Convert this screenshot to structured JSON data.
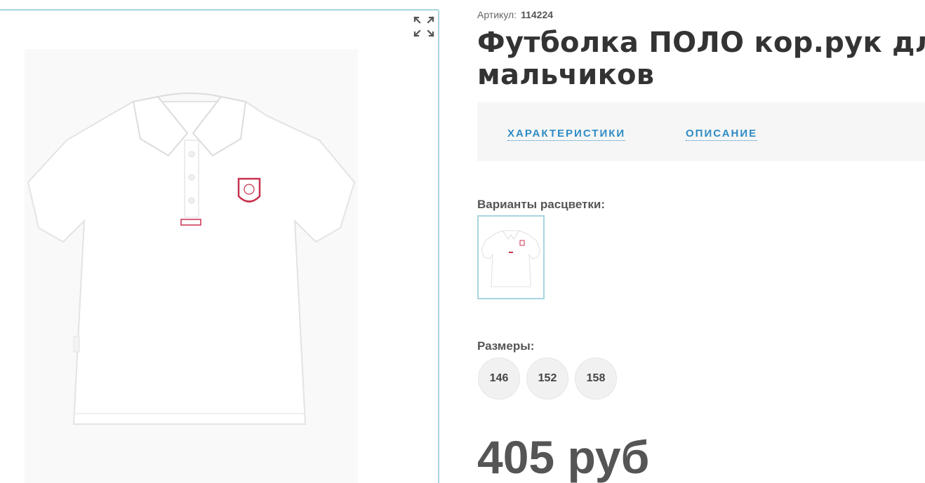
{
  "product": {
    "sku_label": "Артикул:",
    "sku_value": "114224",
    "title": "Футболка ПОЛО кор.рук для\nмальчиков",
    "price": "405 руб"
  },
  "tabs": [
    {
      "label": "ХАРАКТЕРИСТИКИ"
    },
    {
      "label": "ОПИСАНИЕ"
    }
  ],
  "colors": {
    "label": "Варианты расцветки:"
  },
  "sizes": {
    "label": "Размеры:",
    "options": [
      "146",
      "152",
      "158"
    ]
  },
  "gallery": {
    "expand_icon": "expand-arrows-icon"
  },
  "theme": {
    "accent": "#2f8cc4",
    "border": "#a8d4e0",
    "patch": "#c8324f"
  }
}
